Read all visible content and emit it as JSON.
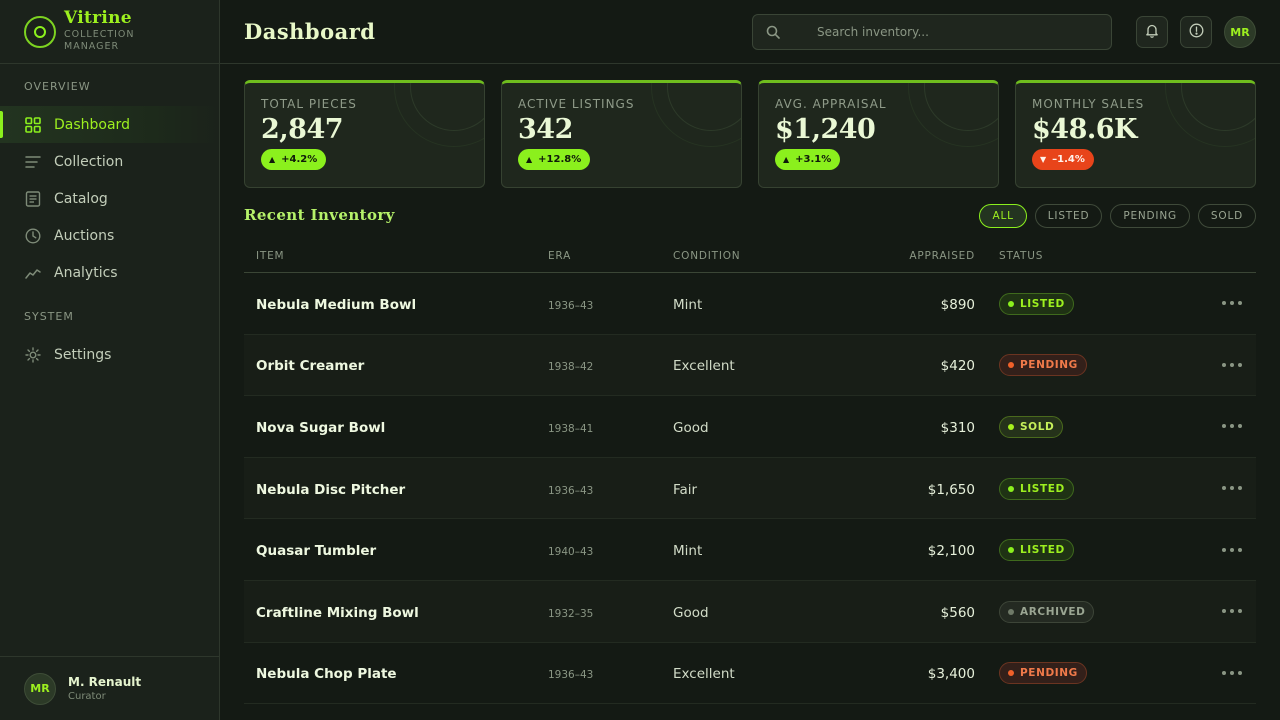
{
  "brand": {
    "name": "Vitrine",
    "sub1": "COLLECTION",
    "sub2": "MANAGER"
  },
  "sidebar": {
    "section_overview": "OVERVIEW",
    "items": [
      {
        "label": "Dashboard",
        "icon": "grid-icon",
        "active": true
      },
      {
        "label": "Collection",
        "icon": "list-icon"
      },
      {
        "label": "Catalog",
        "icon": "document-icon"
      },
      {
        "label": "Auctions",
        "icon": "clock-icon"
      },
      {
        "label": "Analytics",
        "icon": "chart-line-icon"
      }
    ],
    "section_system": "SYSTEM",
    "system_items": [
      {
        "label": "Settings",
        "icon": "gear-icon"
      }
    ]
  },
  "user": {
    "initials": "MR",
    "name": "M. Renault",
    "role": "Curator"
  },
  "header": {
    "title": "Dashboard",
    "search_placeholder": "Search inventory..."
  },
  "cards": [
    {
      "label": "TOTAL PIECES",
      "value": "2,847",
      "delta": "+4.2%",
      "direction": "up"
    },
    {
      "label": "ACTIVE LISTINGS",
      "value": "342",
      "delta": "+12.8%",
      "direction": "up"
    },
    {
      "label": "AVG. APPRAISAL",
      "value": "$1,240",
      "delta": "+3.1%",
      "direction": "up"
    },
    {
      "label": "MONTHLY SALES",
      "value": "$48.6K",
      "delta": "–1.4%",
      "direction": "down"
    }
  ],
  "inventory": {
    "title": "Recent Inventory",
    "filters": [
      "ALL",
      "LISTED",
      "PENDING",
      "SOLD"
    ],
    "active_filter": "ALL",
    "columns": [
      "ITEM",
      "ERA",
      "CONDITION",
      "APPRAISED",
      "STATUS"
    ],
    "rows": [
      {
        "item": "Nebula Medium Bowl",
        "era": "1936–43",
        "condition": "Mint",
        "appraised": "$890",
        "status": "LISTED"
      },
      {
        "item": "Orbit Creamer",
        "era": "1938–42",
        "condition": "Excellent",
        "appraised": "$420",
        "status": "PENDING"
      },
      {
        "item": "Nova Sugar Bowl",
        "era": "1938–41",
        "condition": "Good",
        "appraised": "$310",
        "status": "SOLD"
      },
      {
        "item": "Nebula Disc Pitcher",
        "era": "1936–43",
        "condition": "Fair",
        "appraised": "$1,650",
        "status": "LISTED"
      },
      {
        "item": "Quasar Tumbler",
        "era": "1940–43",
        "condition": "Mint",
        "appraised": "$2,100",
        "status": "LISTED"
      },
      {
        "item": "Craftline Mixing Bowl",
        "era": "1932–35",
        "condition": "Good",
        "appraised": "$560",
        "status": "ARCHIVED"
      },
      {
        "item": "Nebula Chop Plate",
        "era": "1936–43",
        "condition": "Excellent",
        "appraised": "$3,400",
        "status": "PENDING"
      }
    ]
  },
  "colors": {
    "accent": "#8bf01d",
    "negative": "#e8441a",
    "background": "#141a14",
    "surface": "#1f271d"
  }
}
